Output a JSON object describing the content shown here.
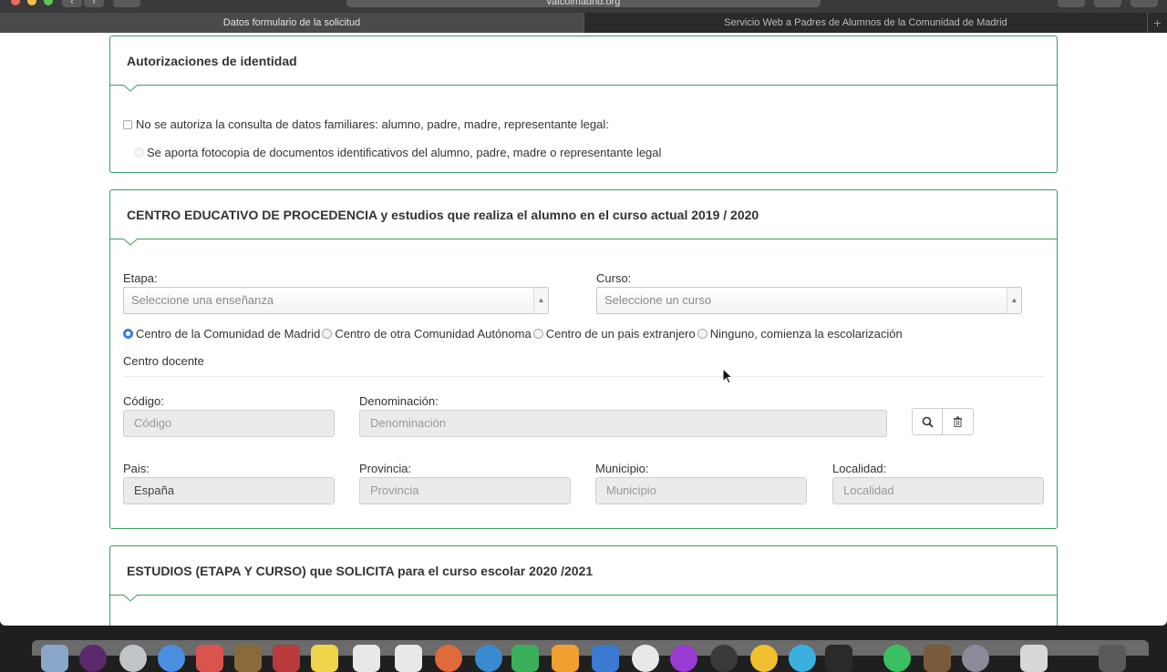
{
  "browser": {
    "url": "valcoimadrid.org",
    "tabs": [
      {
        "label": "Datos formulario de la solicitud",
        "active": true
      },
      {
        "label": "Servicio Web a Padres de Alumnos de la Comunidad de Madrid",
        "active": false
      }
    ],
    "new_tab_label": "+"
  },
  "colors": {
    "accent_green": "#3c9a63",
    "radio_blue": "#3b7de0"
  },
  "autorizaciones": {
    "title": "Autorizaciones de identidad",
    "checkbox_label": "No se autoriza la consulta de datos familiares: alumno, padre, madre, representante legal:",
    "checkbox_checked": false,
    "radio_label": "Se aporta fotocopia de documentos identificativos del alumno, padre, madre o representante legal"
  },
  "centro_procedencia": {
    "title": "CENTRO EDUCATIVO DE PROCEDENCIA y estudios que realiza el alumno en el curso actual 2019 / 2020",
    "etapa_label": "Etapa:",
    "etapa_placeholder": "Seleccione una enseñanza",
    "curso_label": "Curso:",
    "curso_placeholder": "Seleccione un curso",
    "origin_options": [
      {
        "label": "Centro de la Comunidad de Madrid",
        "selected": true
      },
      {
        "label": "Centro de otra Comunidad Autónoma",
        "selected": false
      },
      {
        "label": "Centro de un pais extranjero",
        "selected": false
      },
      {
        "label": "Ninguno, comienza la escolarización",
        "selected": false
      }
    ],
    "centro_docente_label": "Centro docente",
    "codigo_label": "Código:",
    "codigo_placeholder": "Código",
    "denominacion_label": "Denominación:",
    "denominacion_placeholder": "Denominación",
    "search_icon": "search-icon",
    "delete_icon": "trash-icon",
    "pais_label": "Pais:",
    "pais_value": "España",
    "provincia_label": "Provincia:",
    "provincia_placeholder": "Provincia",
    "municipio_label": "Municipio:",
    "municipio_placeholder": "Municipio",
    "localidad_label": "Localidad:",
    "localidad_placeholder": "Localidad"
  },
  "estudios_solicita": {
    "title": "ESTUDIOS (ETAPA Y CURSO) que SOLICITA para el curso escolar 2020 /2021"
  }
}
